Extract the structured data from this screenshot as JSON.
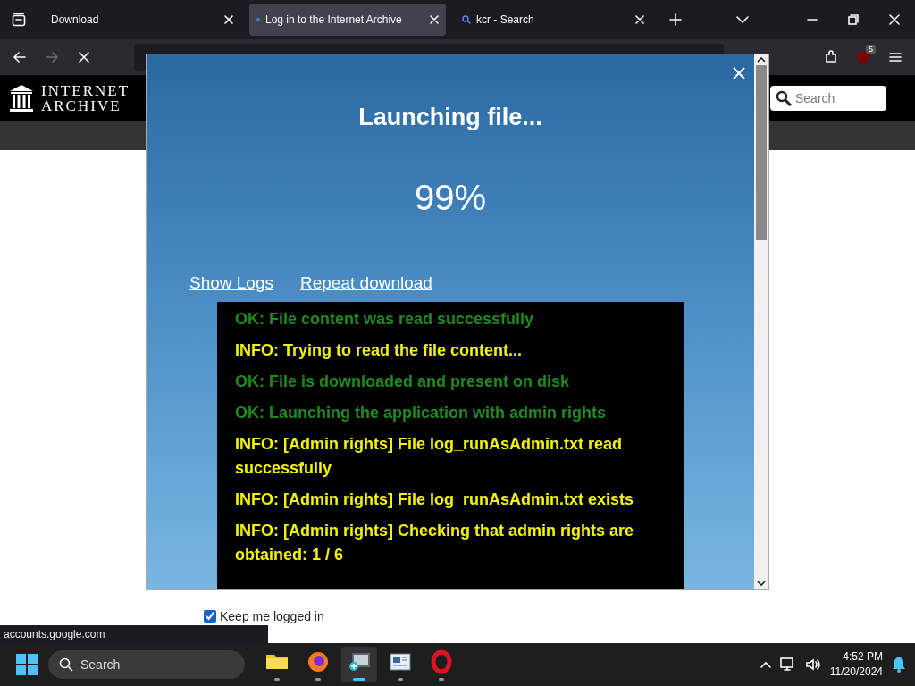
{
  "browser": {
    "tabs": [
      {
        "title": "Download",
        "kind": "plain",
        "selected": false
      },
      {
        "title": "Log in to the Internet Archive",
        "kind": "loading",
        "selected": true
      },
      {
        "title": "kcr - Search",
        "kind": "search",
        "selected": false
      }
    ],
    "forward_disabled": true,
    "extension_badge": "5",
    "status_url": "accounts.google.com"
  },
  "site": {
    "logo_top": "INTERNET",
    "logo_bottom": "ARCHIVE",
    "search_placeholder": "Search"
  },
  "modal": {
    "title": "Launching file...",
    "percent": "99%",
    "links": [
      "Show Logs",
      "Repeat download"
    ],
    "log": [
      {
        "kind": "ok",
        "text": "OK: File content was read successfully"
      },
      {
        "kind": "info",
        "text": "INFO: Trying to read the file content..."
      },
      {
        "kind": "ok",
        "text": "OK: File is downloaded and present on disk"
      },
      {
        "kind": "ok",
        "text": "OK: Launching the application with admin rights"
      },
      {
        "kind": "info",
        "text": "INFO: [Admin rights] File log_runAsAdmin.txt read successfully"
      },
      {
        "kind": "info",
        "text": "INFO: [Admin rights] File log_runAsAdmin.txt exists"
      },
      {
        "kind": "info",
        "text": "INFO: [Admin rights] Checking that admin rights are obtained: 1 / 6"
      }
    ]
  },
  "login": {
    "keep_logged_in": {
      "label": "Keep me logged in",
      "checked": true
    }
  },
  "taskbar": {
    "search_placeholder": "Search",
    "apps": [
      {
        "kind": "folder",
        "active": false
      },
      {
        "kind": "firefox",
        "active": false
      },
      {
        "kind": "terminal",
        "active": true
      },
      {
        "kind": "news",
        "active": false
      },
      {
        "kind": "opera",
        "active": false
      }
    ],
    "time": "4:52 PM",
    "date": "11/20/2024"
  }
}
